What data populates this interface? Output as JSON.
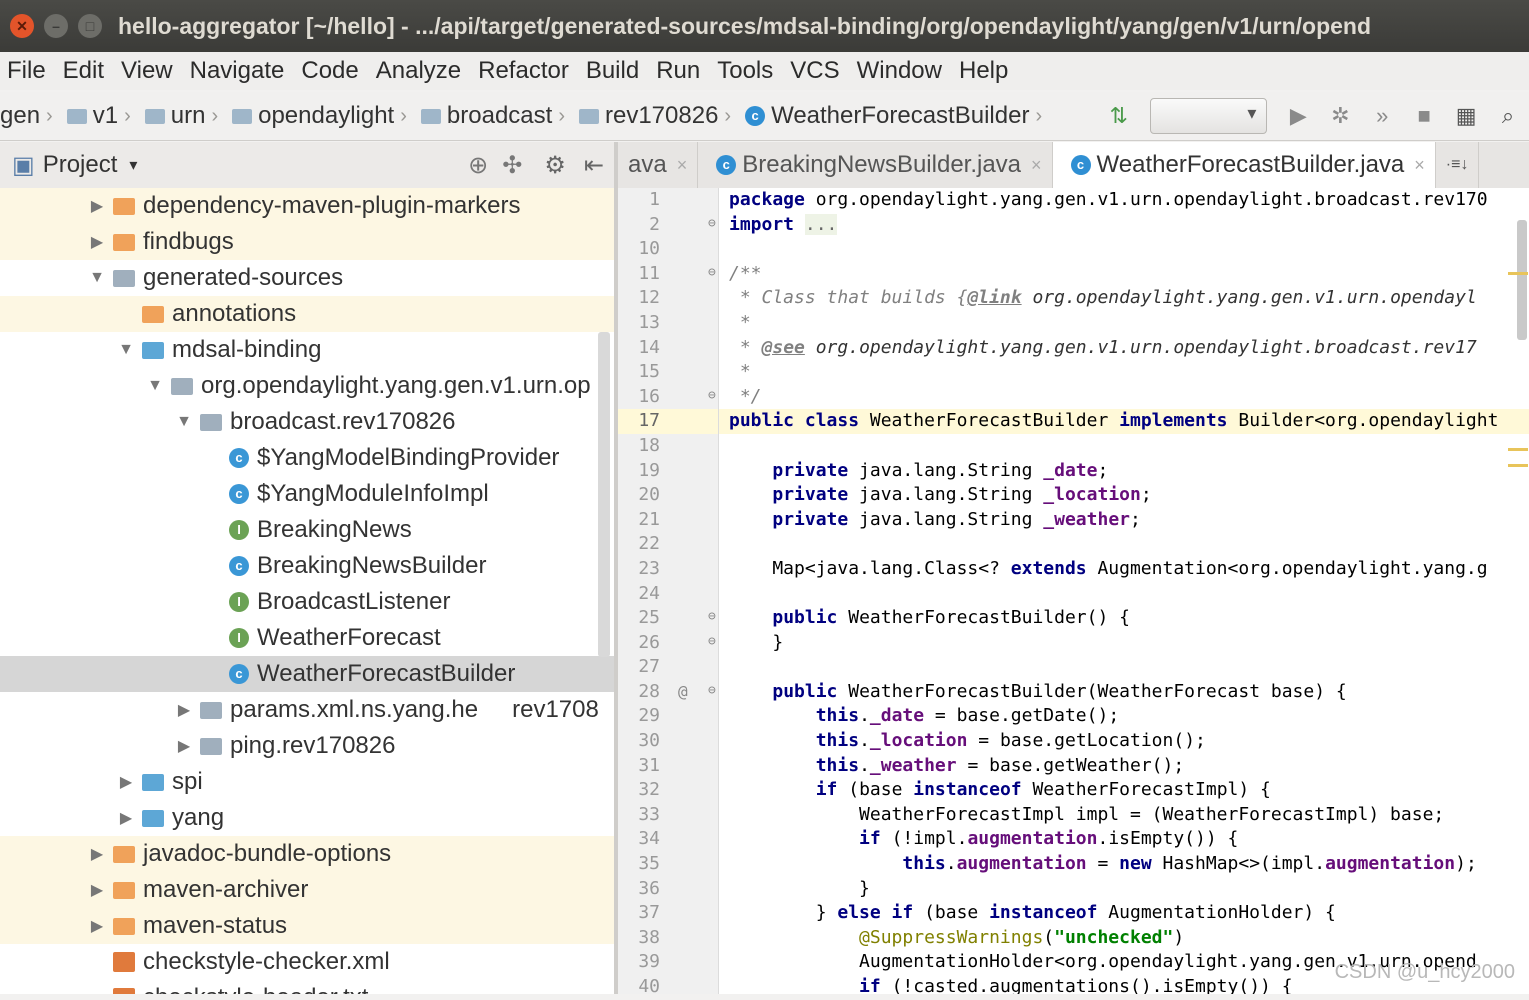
{
  "window": {
    "title": "hello-aggregator [~/hello] - .../api/target/generated-sources/mdsal-binding/org/opendaylight/yang/gen/v1/urn/opend"
  },
  "menu": [
    "File",
    "Edit",
    "View",
    "Navigate",
    "Code",
    "Analyze",
    "Refactor",
    "Build",
    "Run",
    "Tools",
    "VCS",
    "Window",
    "Help"
  ],
  "breadcrumb": [
    "gen",
    "v1",
    "urn",
    "opendaylight",
    "broadcast",
    "rev170826",
    "WeatherForecastBuilder"
  ],
  "project_panel": {
    "title": "Project",
    "tree": [
      {
        "label": "dependency-maven-plugin-markers",
        "arrow": "▶",
        "icon": "folder-orange",
        "indent": 1,
        "hl": true
      },
      {
        "label": "findbugs",
        "arrow": "▶",
        "icon": "folder-orange",
        "indent": 1,
        "hl": true
      },
      {
        "label": "generated-sources",
        "arrow": "▼",
        "icon": "folder-gray",
        "indent": 1,
        "hl": false
      },
      {
        "label": "annotations",
        "arrow": "",
        "icon": "folder-orange",
        "indent": 2,
        "hl": true
      },
      {
        "label": "mdsal-binding",
        "arrow": "▼",
        "icon": "folder-blue",
        "indent": 2,
        "hl": false
      },
      {
        "label": "org.opendaylight.yang.gen.v1.urn.op",
        "arrow": "▼",
        "icon": "folder-gray",
        "indent": 3,
        "hl": false
      },
      {
        "label": "broadcast.rev170826",
        "arrow": "▼",
        "icon": "folder-gray",
        "indent": 4,
        "hl": false
      },
      {
        "label": "$YangModelBindingProvider",
        "arrow": "",
        "icon": "class",
        "indent": 5,
        "hl": false
      },
      {
        "label": "$YangModuleInfoImpl",
        "arrow": "",
        "icon": "class",
        "indent": 5,
        "hl": false
      },
      {
        "label": "BreakingNews",
        "arrow": "",
        "icon": "interface",
        "indent": 5,
        "hl": false
      },
      {
        "label": "BreakingNewsBuilder",
        "arrow": "",
        "icon": "class",
        "indent": 5,
        "hl": false
      },
      {
        "label": "BroadcastListener",
        "arrow": "",
        "icon": "interface",
        "indent": 5,
        "hl": false
      },
      {
        "label": "WeatherForecast",
        "arrow": "",
        "icon": "interface",
        "indent": 5,
        "hl": false
      },
      {
        "label": "WeatherForecastBuilder",
        "arrow": "",
        "icon": "class",
        "indent": 5,
        "hl": false,
        "selected": true
      },
      {
        "label": "params.xml.ns.yang.he",
        "arrow": "▶",
        "icon": "folder-gray",
        "indent": 4,
        "hl": false,
        "suffix": "rev1708"
      },
      {
        "label": "ping.rev170826",
        "arrow": "▶",
        "icon": "folder-gray",
        "indent": 4,
        "hl": false
      },
      {
        "label": "spi",
        "arrow": "▶",
        "icon": "folder-blue",
        "indent": 2,
        "hl": false
      },
      {
        "label": "yang",
        "arrow": "▶",
        "icon": "folder-blue",
        "indent": 2,
        "hl": false
      },
      {
        "label": "javadoc-bundle-options",
        "arrow": "▶",
        "icon": "folder-orange",
        "indent": 1,
        "hl": true
      },
      {
        "label": "maven-archiver",
        "arrow": "▶",
        "icon": "folder-orange",
        "indent": 1,
        "hl": true
      },
      {
        "label": "maven-status",
        "arrow": "▶",
        "icon": "folder-orange",
        "indent": 1,
        "hl": true
      },
      {
        "label": "checkstyle-checker.xml",
        "arrow": "",
        "icon": "xml",
        "indent": 1,
        "hl": false
      },
      {
        "label": "checkstyle-header.txt",
        "arrow": "",
        "icon": "xml",
        "indent": 1,
        "hl": false
      }
    ]
  },
  "tabs": [
    {
      "label": "ava",
      "active": false
    },
    {
      "label": "BreakingNewsBuilder.java",
      "active": false
    },
    {
      "label": "WeatherForecastBuilder.java",
      "active": true
    }
  ],
  "editor": {
    "line_numbers": [
      "1",
      "2",
      "10",
      "11",
      "12",
      "13",
      "14",
      "15",
      "16",
      "17",
      "18",
      "19",
      "20",
      "21",
      "22",
      "23",
      "24",
      "25",
      "26",
      "27",
      "28",
      "29",
      "30",
      "31",
      "32",
      "33",
      "34",
      "35",
      "36",
      "37",
      "38",
      "39",
      "40"
    ],
    "current_line_index": 9,
    "gutter_at": "@"
  },
  "watermark": "CSDN @u_hcy2000"
}
